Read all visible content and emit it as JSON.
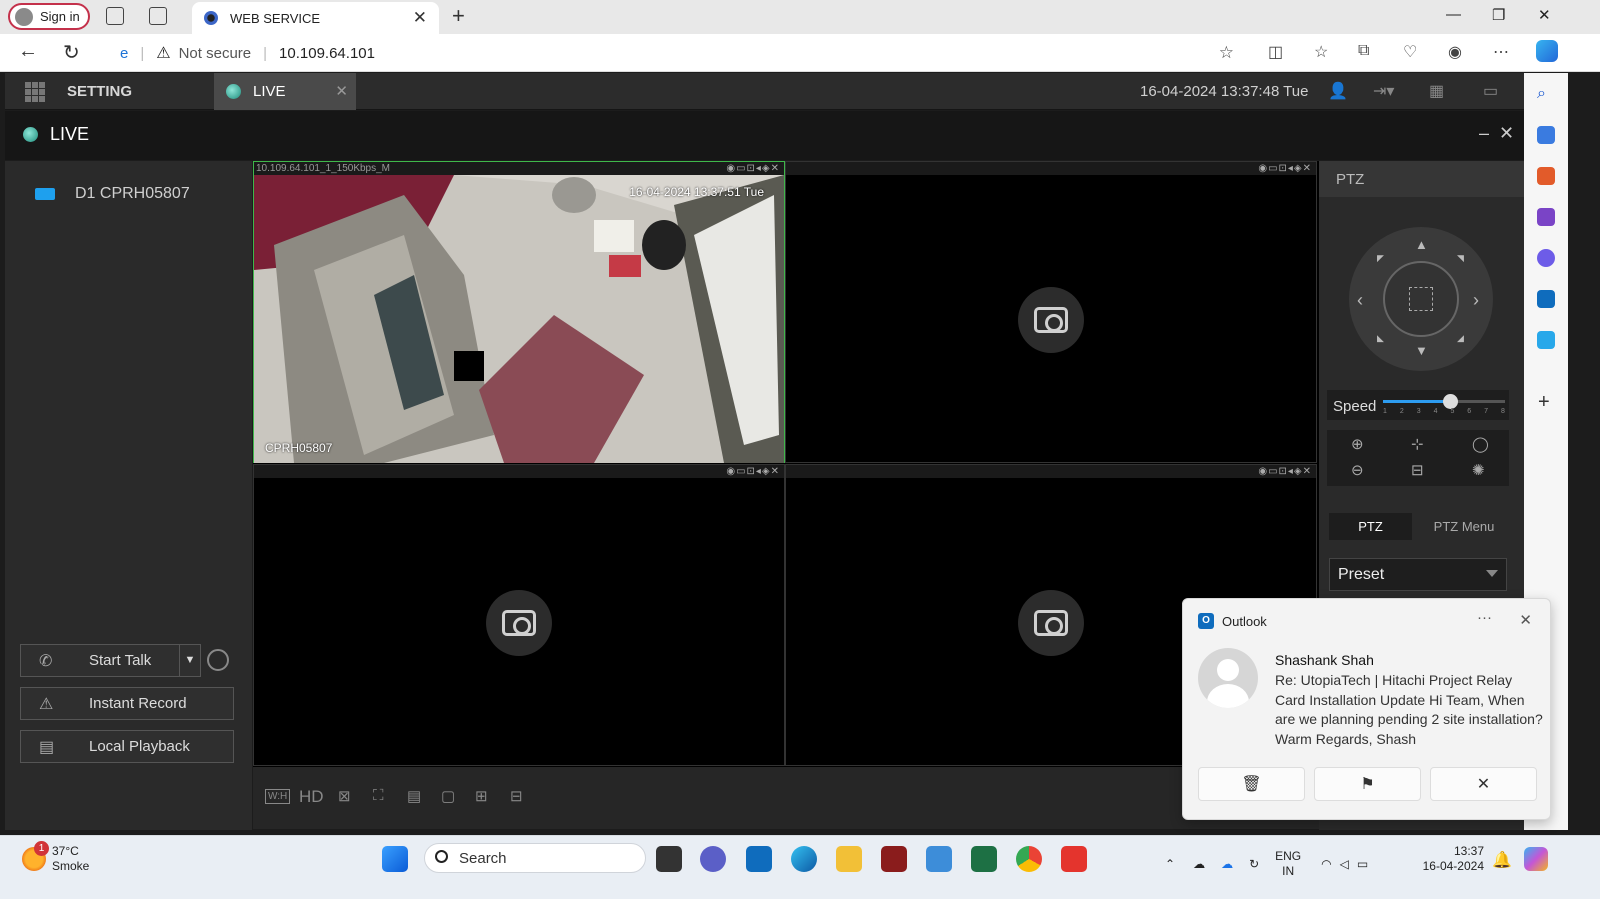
{
  "browser": {
    "signin_label": "Sign in",
    "tab_title": "WEB SERVICE",
    "security_label": "Not secure",
    "url": "10.109.64.101"
  },
  "app": {
    "setting_label": "SETTING",
    "live_tab_label": "LIVE",
    "datetime": "16-04-2024 13:37:48 Tue",
    "live_header": "LIVE",
    "device_name": "D1 CPRH05807",
    "buttons": {
      "start_talk": "Start Talk",
      "instant_record": "Instant Record",
      "local_playback": "Local Playback"
    },
    "video": {
      "pane1_title": "10.109.64.101_1_150Kbps_M",
      "osd_timestamp": "16-04-2024 13:37:51 Tue",
      "osd_camera_name": "CPRH05807"
    },
    "bottom_bar": {
      "wh_label": "W:H",
      "hd_label": "HD"
    },
    "ptz": {
      "title": "PTZ",
      "speed_label": "Speed",
      "speed_ticks": [
        "1",
        "2",
        "3",
        "4",
        "5",
        "6",
        "7",
        "8"
      ],
      "speed_value": 5,
      "tab_ptz": "PTZ",
      "tab_ptz_menu": "PTZ Menu",
      "preset_label": "Preset"
    }
  },
  "notification": {
    "app_name": "Outlook",
    "sender": "Shashank Shah",
    "body": "Re: UtopiaTech | Hitachi Project Relay Card Installation Update Hi Team,  When are we planning pending 2 site installation?  Warm Regards,  Shash"
  },
  "taskbar": {
    "weather_temp": "37°C",
    "weather_desc": "Smoke",
    "weather_badge": "1",
    "search_label": "Search",
    "lang_top": "ENG",
    "lang_bottom": "IN",
    "time": "13:37",
    "date": "16-04-2024"
  },
  "colors": {
    "accent_blue": "#1ea0ee",
    "live_dot": "#1d8c7b",
    "selected_border": "#3fb74a",
    "signin_border": "#c4314b"
  }
}
